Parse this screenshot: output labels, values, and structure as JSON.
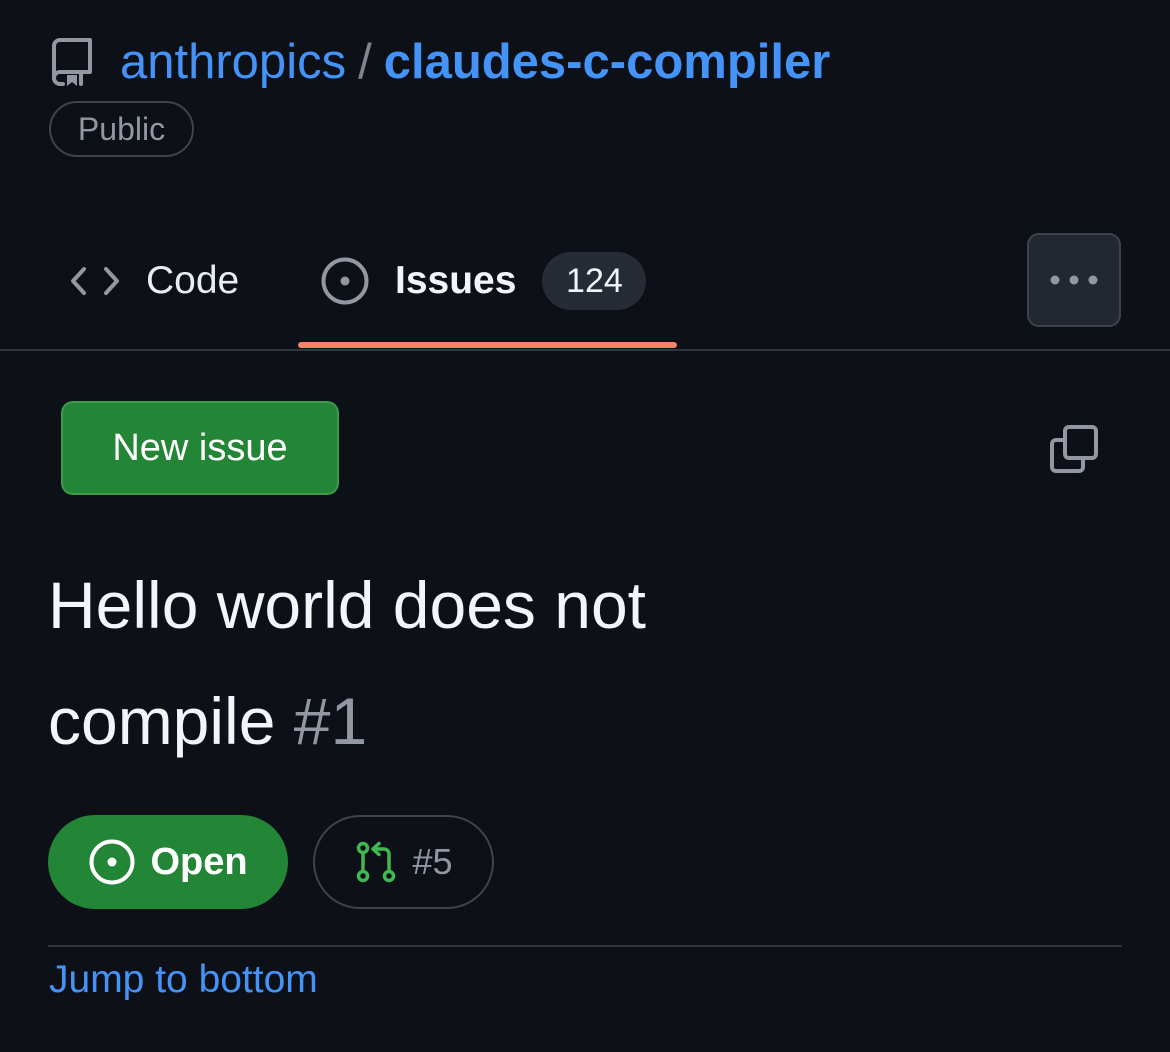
{
  "repo": {
    "icon": "repo-icon",
    "owner": "anthropics",
    "separator": "/",
    "name": "claudes-c-compiler",
    "visibility": "Public"
  },
  "tabs": [
    {
      "icon": "code-icon",
      "label": "Code",
      "active": false
    },
    {
      "icon": "issue-opened-icon",
      "label": "Issues",
      "count": "124",
      "active": true
    }
  ],
  "toolbar": {
    "more_icon": "kebab-horizontal-icon",
    "new_issue_label": "New issue",
    "copy_icon": "copy-icon"
  },
  "issue": {
    "title": "Hello world does not compile",
    "number": "#1",
    "state_icon": "issue-opened-icon",
    "state": "Open",
    "linked_pr_icon": "git-pull-request-icon",
    "linked_pr": "#5",
    "jump_link": "Jump to bottom"
  },
  "colors": {
    "background": "#0d1117",
    "link": "#4493f8",
    "success": "#238636",
    "active_tab_underline": "#f78166",
    "pr_open": "#3fb950"
  }
}
